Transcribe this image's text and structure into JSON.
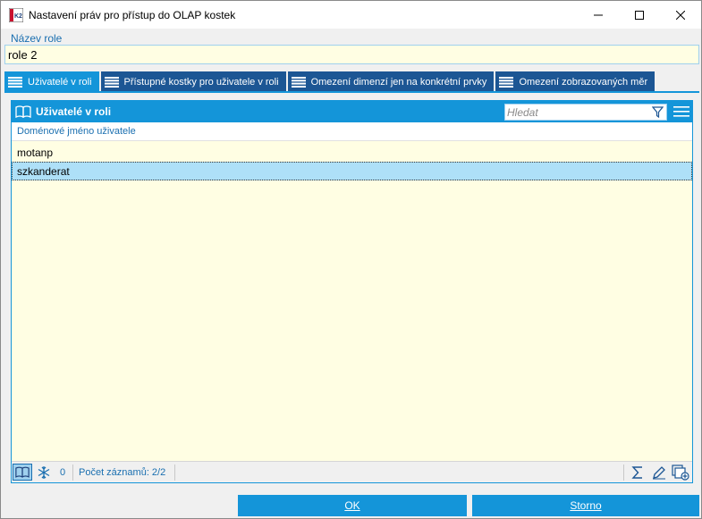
{
  "window": {
    "title": "Nastavení práv pro přístup do OLAP kostek",
    "icon": "app-logo-icon"
  },
  "role": {
    "label": "Název role",
    "value": "role 2"
  },
  "tabs": [
    {
      "label": "Uživatelé v roli",
      "active": true
    },
    {
      "label": "Přístupné kostky pro uživatele v roli",
      "active": false
    },
    {
      "label": "Omezení dimenzí jen na konkrétní prvky",
      "active": false
    },
    {
      "label": "Omezení zobrazovaných měr",
      "active": false
    }
  ],
  "panel": {
    "title": "Uživatelé v roli",
    "search_placeholder": "Hledat",
    "column_header": "Doménové jméno uživatele",
    "rows": [
      "motanp",
      "szkanderat"
    ],
    "selected_row": 1
  },
  "status": {
    "count": "0",
    "records": "Počet záznamů: 2/2"
  },
  "buttons": {
    "ok": "OK",
    "storno": "Storno"
  },
  "colors": {
    "accent": "#1495d9",
    "tab_inactive": "#1c5694",
    "grid_background": "#fffee3",
    "selected_row": "#aee0f8",
    "label_blue": "#1a6fb0"
  }
}
